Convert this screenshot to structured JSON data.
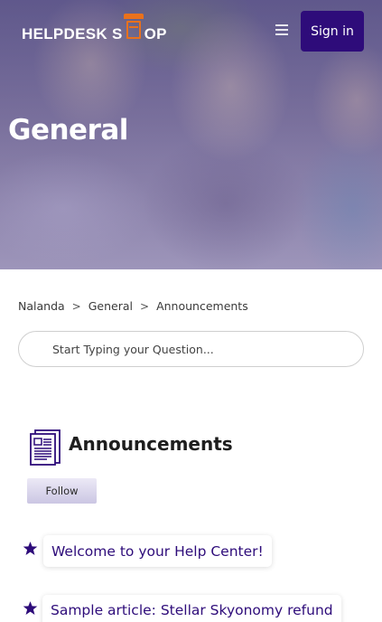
{
  "header": {
    "logo_left": "HELPDESK S",
    "logo_right": "OP",
    "signin_label": "Sign in"
  },
  "hero": {
    "title": "General"
  },
  "breadcrumb": [
    "Nalanda",
    "General",
    "Announcements"
  ],
  "search": {
    "placeholder": "Start Typing your Question..."
  },
  "section": {
    "title": "Announcements",
    "follow_label": "Follow"
  },
  "articles": [
    "Welcome to your Help Center!",
    "Sample article: Stellar Skyonomy refund"
  ],
  "colors": {
    "brand": "#2e0c7a",
    "logo_accent": "#e9711c"
  },
  "icons": [
    "menu-icon",
    "document-icon",
    "star-icon"
  ]
}
